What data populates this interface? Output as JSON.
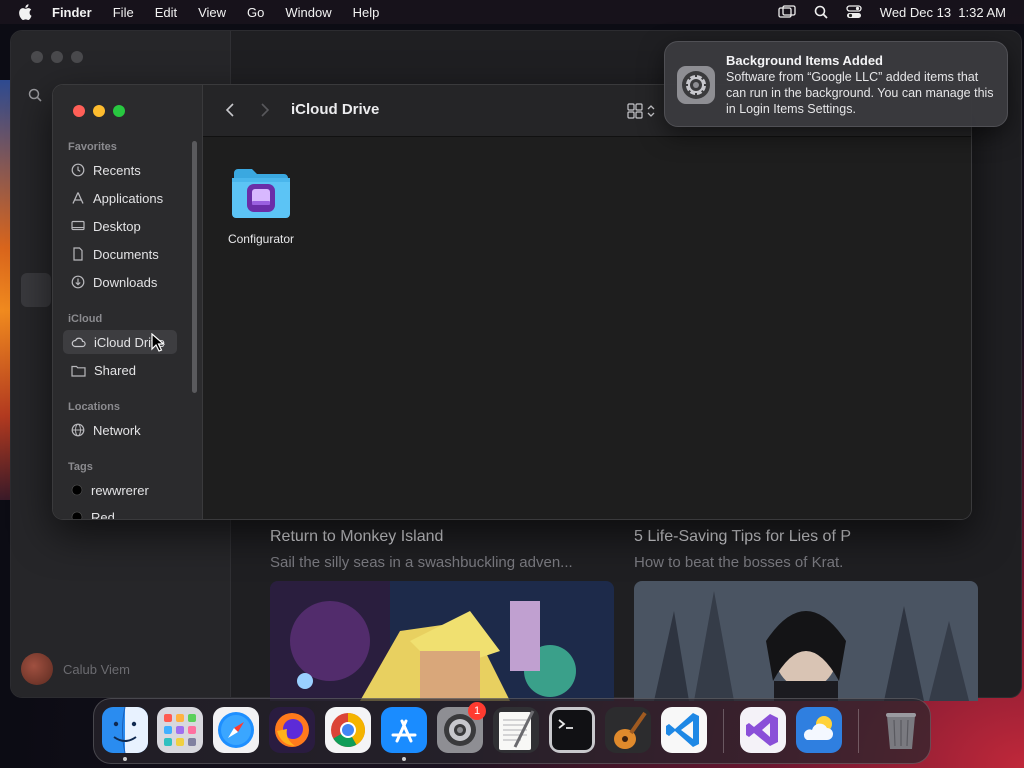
{
  "menubar": {
    "app": "Finder",
    "items": [
      "File",
      "Edit",
      "View",
      "Go",
      "Window",
      "Help"
    ],
    "datetime": "Wed Dec 13  1:32 AM",
    "status_icons": [
      "screen-mirror-icon",
      "spotlight-icon",
      "control-center-icon"
    ]
  },
  "background_window": {
    "user_name": "Calub Viem",
    "cards": [
      {
        "title": "Return to Monkey Island",
        "subtitle": "Sail the silly seas in a swashbuckling adven..."
      },
      {
        "title": "5 Life-Saving Tips for Lies of P",
        "subtitle": "How to beat the bosses of Krat."
      }
    ]
  },
  "finder": {
    "title": "iCloud Drive",
    "sidebar": {
      "favorites_header": "Favorites",
      "favorites": [
        {
          "label": "Recents",
          "icon": "clock-icon"
        },
        {
          "label": "Applications",
          "icon": "applications-icon"
        },
        {
          "label": "Desktop",
          "icon": "desktop-icon"
        },
        {
          "label": "Documents",
          "icon": "document-icon"
        },
        {
          "label": "Downloads",
          "icon": "download-icon"
        }
      ],
      "icloud_header": "iCloud",
      "icloud": [
        {
          "label": "iCloud Drive",
          "icon": "cloud-icon",
          "selected": true
        },
        {
          "label": "Shared",
          "icon": "shared-folder-icon"
        }
      ],
      "locations_header": "Locations",
      "locations": [
        {
          "label": "Network",
          "icon": "globe-icon"
        }
      ],
      "tags_header": "Tags",
      "tags": [
        {
          "label": "rewwrerer",
          "color": "#000000"
        },
        {
          "label": "Red",
          "color": "#000000"
        }
      ]
    },
    "files": [
      {
        "name": "Configurator",
        "icon": "folder-icon"
      }
    ]
  },
  "notification": {
    "title": "Background Items Added",
    "body": "Software from “Google LLC” added items that can run in the background. You can manage this in Login Items Settings."
  },
  "dock": {
    "apps": [
      "Finder",
      "Launchpad",
      "Safari",
      "Firefox",
      "Chrome",
      "App Store",
      "System Settings",
      "TextEdit",
      "Terminal",
      "GarageBand",
      "Visual Studio Code",
      "Visual Studio",
      "Weather",
      "Trash"
    ],
    "badge": "1"
  }
}
